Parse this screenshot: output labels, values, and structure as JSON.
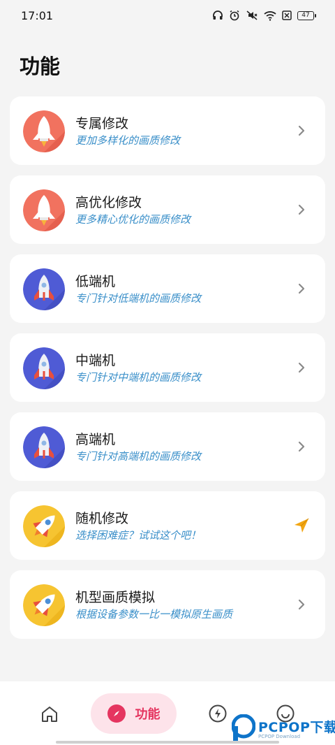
{
  "status_bar": {
    "time": "17:01",
    "battery": "47",
    "icons": [
      "headphones-icon",
      "alarm-icon",
      "mute-icon",
      "wifi-icon",
      "sim-off-icon",
      "battery-icon"
    ]
  },
  "page": {
    "title": "功能"
  },
  "cards": [
    {
      "title": "专属修改",
      "subtitle": "更加多样化的画质修改",
      "icon": "rocket-red-icon",
      "action": "chevron-right-icon"
    },
    {
      "title": "高优化修改",
      "subtitle": "更多精心优化的画质修改",
      "icon": "rocket-red-icon",
      "action": "chevron-right-icon"
    },
    {
      "title": "低端机",
      "subtitle": "专门针对低端机的画质修改",
      "icon": "rocket-blue-icon",
      "action": "chevron-right-icon"
    },
    {
      "title": "中端机",
      "subtitle": "专门针对中端机的画质修改",
      "icon": "rocket-blue-icon",
      "action": "chevron-right-icon"
    },
    {
      "title": "高端机",
      "subtitle": "专门针对高端机的画质修改",
      "icon": "rocket-blue-icon",
      "action": "chevron-right-icon"
    },
    {
      "title": "随机修改",
      "subtitle": "选择困难症？试试这个吧！",
      "icon": "rocket-yellow-icon",
      "action": "send-arrow-icon"
    },
    {
      "title": "机型画质模拟",
      "subtitle": "根据设备参数一比一模拟原生画质",
      "icon": "rocket-yellow-icon",
      "action": "chevron-right-icon"
    }
  ],
  "bottom_nav": {
    "items": [
      {
        "icon": "home-icon"
      },
      {
        "icon": "compass-icon",
        "label": "功能",
        "active": true
      },
      {
        "icon": "bolt-icon"
      },
      {
        "icon": "smile-icon"
      }
    ]
  },
  "watermark": {
    "text": "PCPOP下载",
    "sub": "PCPOP Download"
  },
  "colors": {
    "accent": "#e53560",
    "subtitle": "#3a8fc9",
    "background": "#f4f4f4",
    "card": "#ffffff"
  }
}
